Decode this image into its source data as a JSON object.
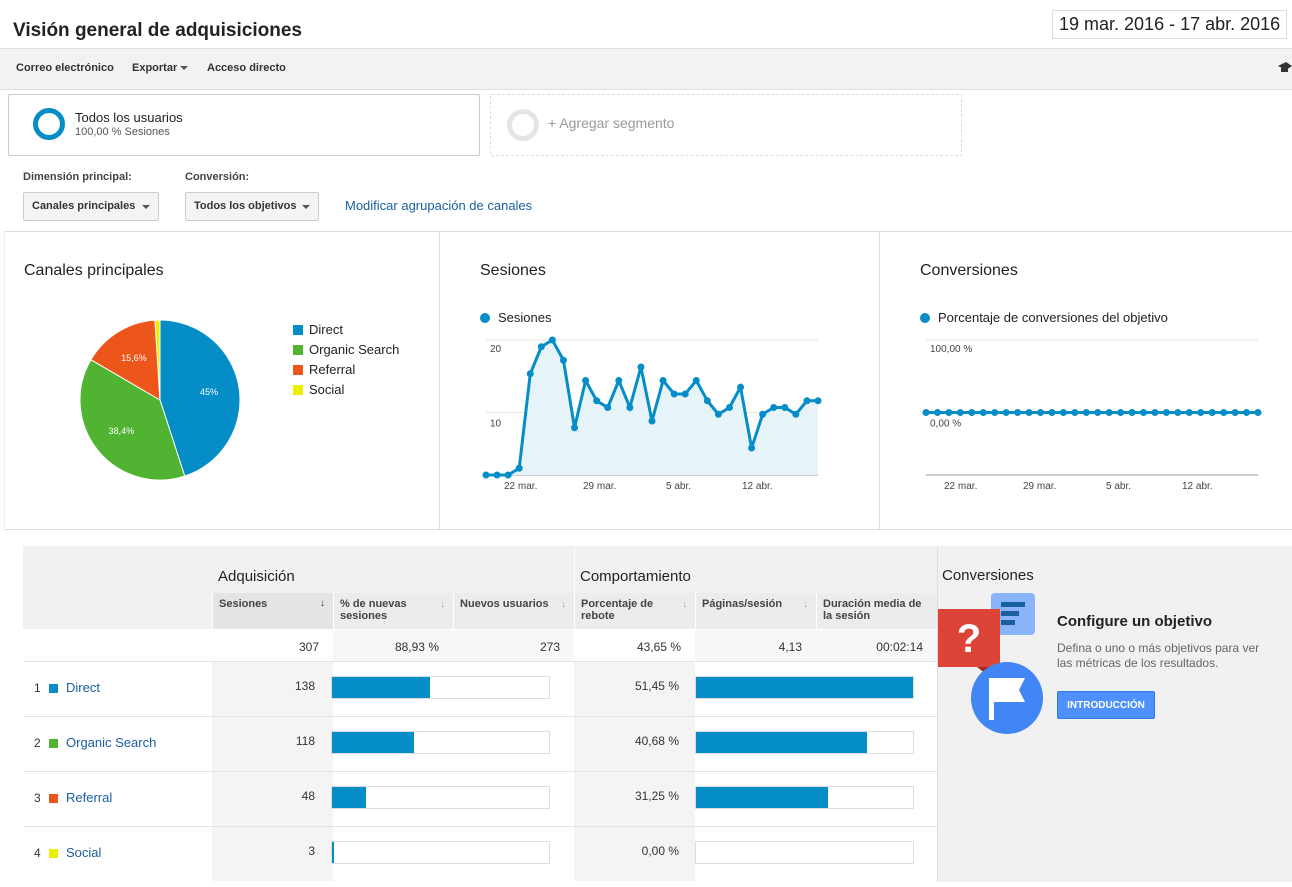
{
  "header": {
    "title": "Visión general de adquisiciones",
    "date_range": "19 mar. 2016 - 17 abr. 2016"
  },
  "toolbar": {
    "email_label": "Correo electrónico",
    "export_label": "Exportar",
    "shortcut_label": "Acceso directo",
    "right_icon": "graduation-cap-icon"
  },
  "segments": {
    "all_users_name": "Todos los usuarios",
    "all_users_sub": "100,00 % Sesiones",
    "add_segment_label": "+ Agregar segmento"
  },
  "dimensions": {
    "primary_label": "Dimensión principal:",
    "primary_value": "Canales principales",
    "conversion_label": "Conversión:",
    "conversion_value": "Todos los objetivos",
    "modify_link": "Modificar agrupación de canales"
  },
  "colors": {
    "accent": "#058dc7",
    "direct": "#058dc7",
    "organic": "#50b432",
    "referral": "#ed561b",
    "social": "#edef00",
    "link": "#1a5fa0"
  },
  "charts": {
    "channels_title": "Canales principales",
    "sessions_title": "Sesiones",
    "conversions_title": "Conversiones"
  },
  "chart_data": [
    {
      "type": "pie",
      "categories": [
        "Direct",
        "Organic Search",
        "Referral",
        "Social"
      ],
      "values": [
        45,
        38.4,
        15.6,
        1
      ],
      "labels": [
        "45%",
        "38,4%",
        "15,6%",
        ""
      ],
      "legend": "right"
    },
    {
      "type": "area",
      "series": [
        {
          "name": "Sesiones",
          "values": [
            0,
            0,
            0,
            1,
            15,
            19,
            20,
            17,
            7,
            14,
            11,
            10,
            14,
            10,
            16,
            8,
            14,
            12,
            12,
            14,
            11,
            9,
            10,
            13,
            4,
            9,
            10,
            10,
            9,
            11,
            11
          ]
        }
      ],
      "xticks": [
        "22 mar.",
        "29 mar.",
        "5 abr.",
        "12 abr."
      ],
      "yticks": [
        "10",
        "20"
      ],
      "ylim": [
        0,
        20
      ],
      "grid": true
    },
    {
      "type": "line",
      "series": [
        {
          "name": "Porcentaje de conversiones del objetivo",
          "values": [
            0,
            0,
            0,
            0,
            0,
            0,
            0,
            0,
            0,
            0,
            0,
            0,
            0,
            0,
            0,
            0,
            0,
            0,
            0,
            0,
            0,
            0,
            0,
            0,
            0,
            0,
            0,
            0,
            0,
            0
          ]
        }
      ],
      "xticks": [
        "22 mar.",
        "29 mar.",
        "5 abr.",
        "12 abr."
      ],
      "yticks": [
        "0,00 %",
        "100,00 %"
      ],
      "grid": true
    }
  ],
  "table": {
    "group_acquisition": "Adquisición",
    "group_behavior": "Comportamiento",
    "columns": [
      "Sesiones",
      "% de nuevas sesiones",
      "Nuevos usuarios",
      "Porcentaje de rebote",
      "Páginas/sesión",
      "Duración media de la sesión"
    ],
    "totals": [
      "307",
      "88,93 %",
      "273",
      "43,65 %",
      "4,13",
      "00:02:14"
    ],
    "rows": [
      {
        "num": "1",
        "name": "Direct",
        "sessions": "138",
        "new_sessions_frac": 0.45,
        "bounce": "51,45 %",
        "pages_frac": 1.0
      },
      {
        "num": "2",
        "name": "Organic Search",
        "sessions": "118",
        "new_sessions_frac": 0.38,
        "bounce": "40,68 %",
        "pages_frac": 0.79
      },
      {
        "num": "3",
        "name": "Referral",
        "sessions": "48",
        "new_sessions_frac": 0.156,
        "bounce": "31,25 %",
        "pages_frac": 0.61
      },
      {
        "num": "4",
        "name": "Social",
        "sessions": "3",
        "new_sessions_frac": 0.01,
        "bounce": "0,00 %",
        "pages_frac": 0.0
      }
    ]
  },
  "conversions_panel": {
    "title": "Conversiones",
    "heading": "Configure un objetivo",
    "description": "Defina o uno o más objetivos para ver las métricas de los resultados.",
    "button_label": "INTRODUCCIÓN"
  }
}
